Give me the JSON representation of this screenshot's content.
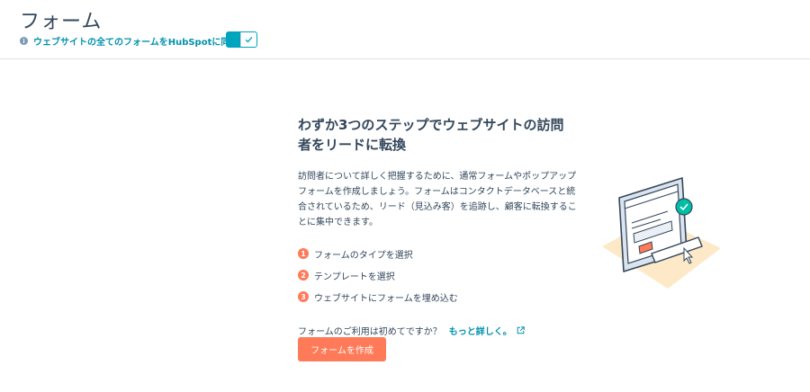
{
  "header": {
    "title": "フォーム",
    "sync_label": "ウェブサイトの全てのフォームをHubSpotに同期",
    "sync_enabled": true
  },
  "main": {
    "heading": "わずか3つのステップでウェブサイトの訪問者をリードに転換",
    "description": "訪問者について詳しく把握するために、通常フォームやポップアップフォームを作成しましょう。フォームはコンタクトデータベースと統合されているため、リード（見込み客）を追跡し、顧客に転換することに集中できます。",
    "steps": [
      {
        "number": "1",
        "label": "フォームのタイプを選択"
      },
      {
        "number": "2",
        "label": "テンプレートを選択"
      },
      {
        "number": "3",
        "label": "ウェブサイトにフォームを埋め込む"
      }
    ],
    "learn_prompt": "フォームのご利用は初めてですか？",
    "learn_link": "もっと詳しく。",
    "cta_label": "フォームを作成"
  },
  "colors": {
    "accent": "#ff7a59",
    "link": "#0091ae",
    "toggle": "#00a4bd",
    "text": "#33475b"
  }
}
